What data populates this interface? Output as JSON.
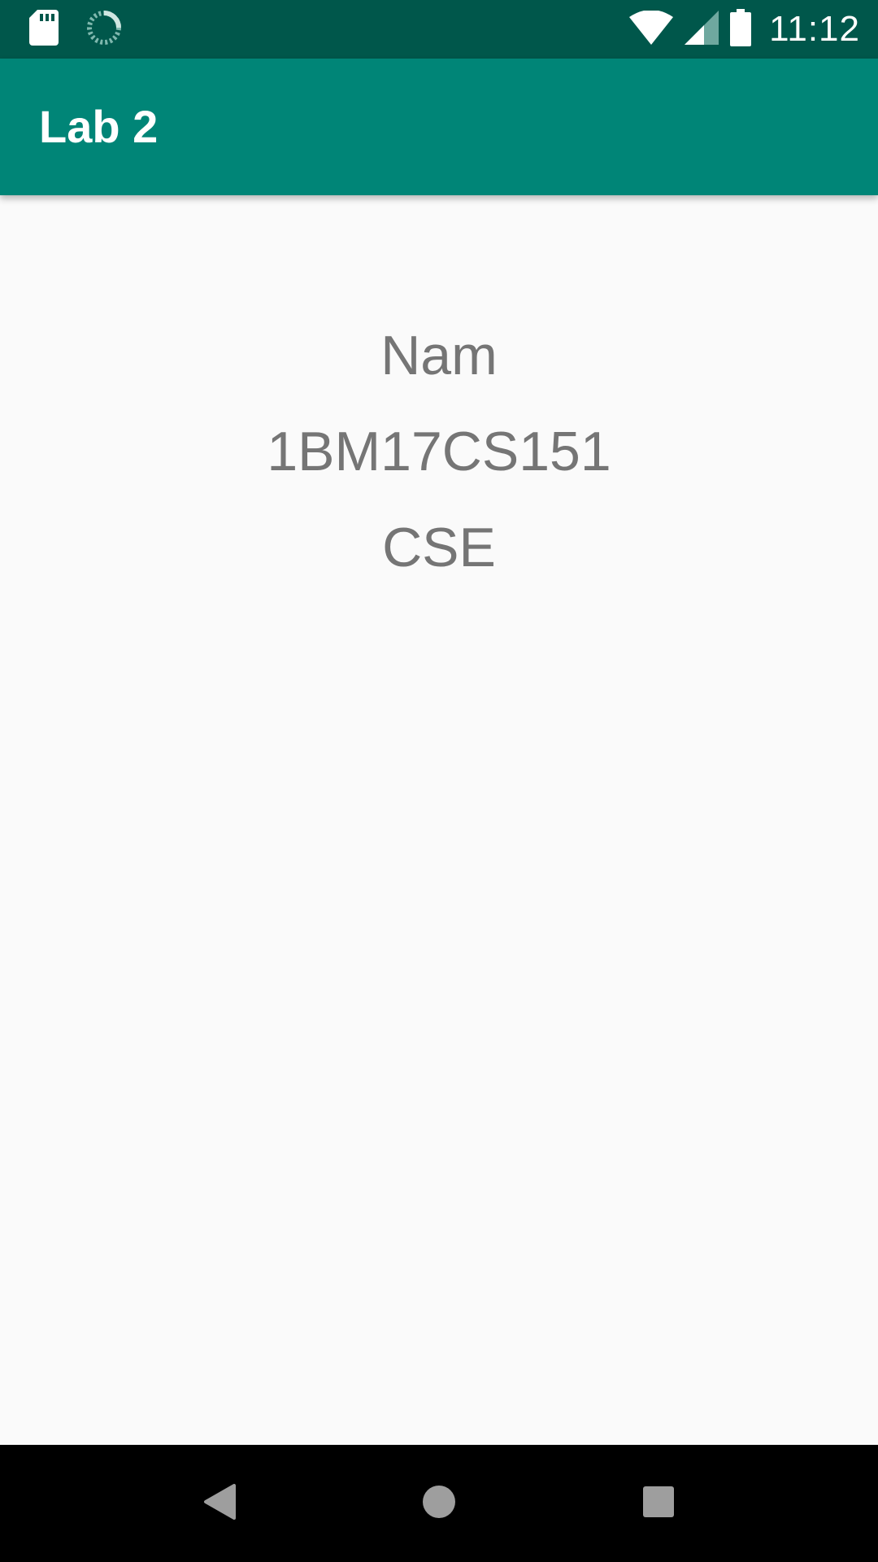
{
  "status_bar": {
    "time": "11:12",
    "icons": [
      "sd-card-icon",
      "sync-icon",
      "wifi-icon",
      "cell-signal-icon",
      "battery-icon"
    ]
  },
  "app_bar": {
    "title": "Lab 2"
  },
  "content": {
    "name": "Nam",
    "usn": "1BM17CS151",
    "department": "CSE"
  },
  "nav_bar": {
    "icons": [
      "back-icon",
      "home-icon",
      "recents-icon"
    ]
  },
  "colors": {
    "status_bar": "#00574B",
    "app_bar": "#008577",
    "background": "#FAFAFA",
    "text": "#757575",
    "nav_bar": "#000000"
  }
}
